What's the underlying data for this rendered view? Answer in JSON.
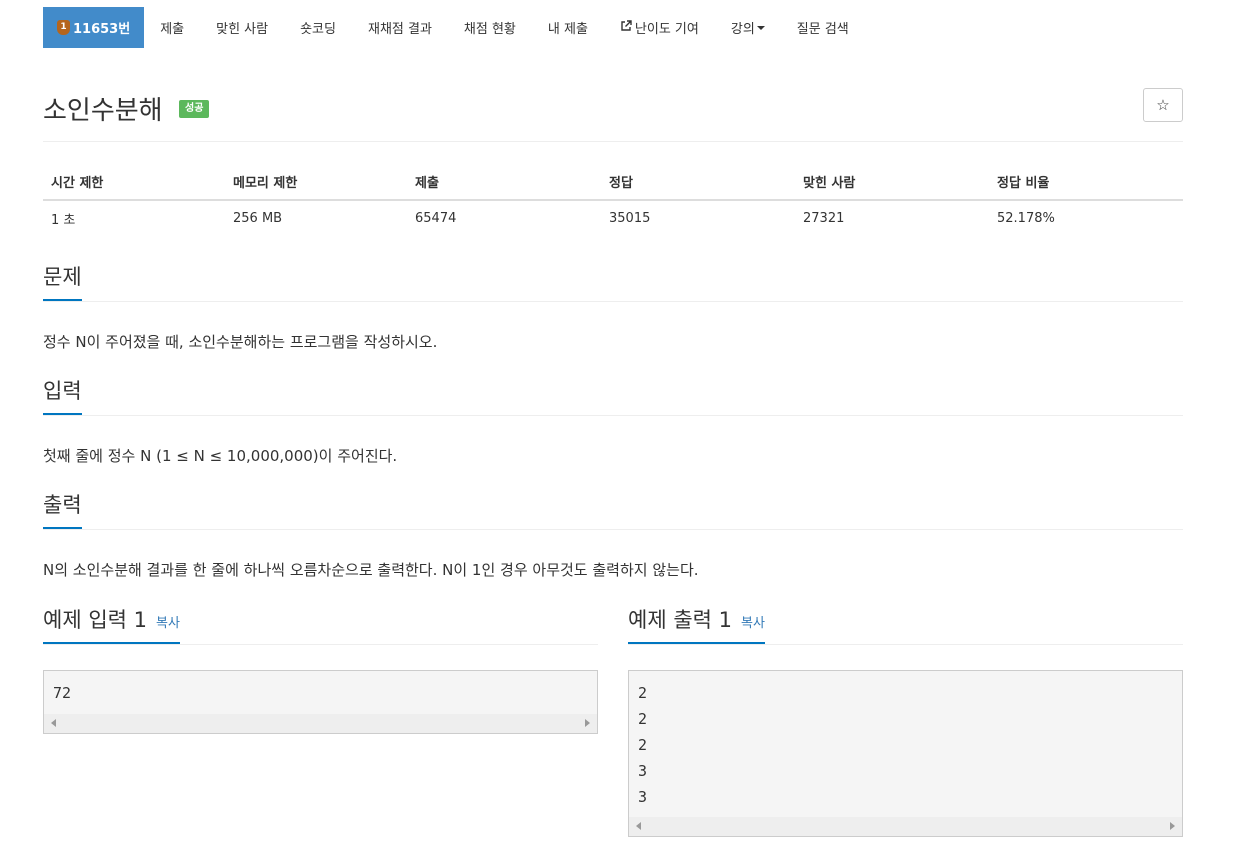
{
  "nav": {
    "problem_id": "11653번",
    "problem_badge": "1",
    "items": [
      "제출",
      "맞힌 사람",
      "숏코딩",
      "재채점 결과",
      "채점 현황",
      "내 제출",
      "난이도 기여",
      "강의",
      "질문 검색"
    ]
  },
  "problem": {
    "title": "소인수분해",
    "status_label": "성공",
    "star": "☆"
  },
  "info_table": {
    "headers": [
      "시간 제한",
      "메모리 제한",
      "제출",
      "정답",
      "맞힌 사람",
      "정답 비율"
    ],
    "values": [
      "1 초",
      "256 MB",
      "65474",
      "35015",
      "27321",
      "52.178%"
    ]
  },
  "sections": {
    "description": {
      "title": "문제",
      "text": "정수 N이 주어졌을 때, 소인수분해하는 프로그램을 작성하시오."
    },
    "input": {
      "title": "입력",
      "text": "첫째 줄에 정수 N (1 ≤ N ≤ 10,000,000)이 주어진다."
    },
    "output": {
      "title": "출력",
      "text": "N의 소인수분해 결과를 한 줄에 하나씩 오름차순으로 출력한다. N이 1인 경우 아무것도 출력하지 않는다."
    }
  },
  "samples": {
    "input": {
      "title": "예제 입력 1",
      "copy": "복사",
      "lines": [
        "72"
      ]
    },
    "output": {
      "title": "예제 출력 1",
      "copy": "복사",
      "lines": [
        "2",
        "2",
        "2",
        "3",
        "3"
      ]
    }
  },
  "colors": {
    "nav_active": "#428bca",
    "success": "#5cb85c",
    "link": "#337ab7",
    "section_underline": "#0076c0"
  },
  "icons": {
    "badge": "bronze-tier-icon",
    "external": "external-link-icon",
    "star": "star-icon"
  }
}
